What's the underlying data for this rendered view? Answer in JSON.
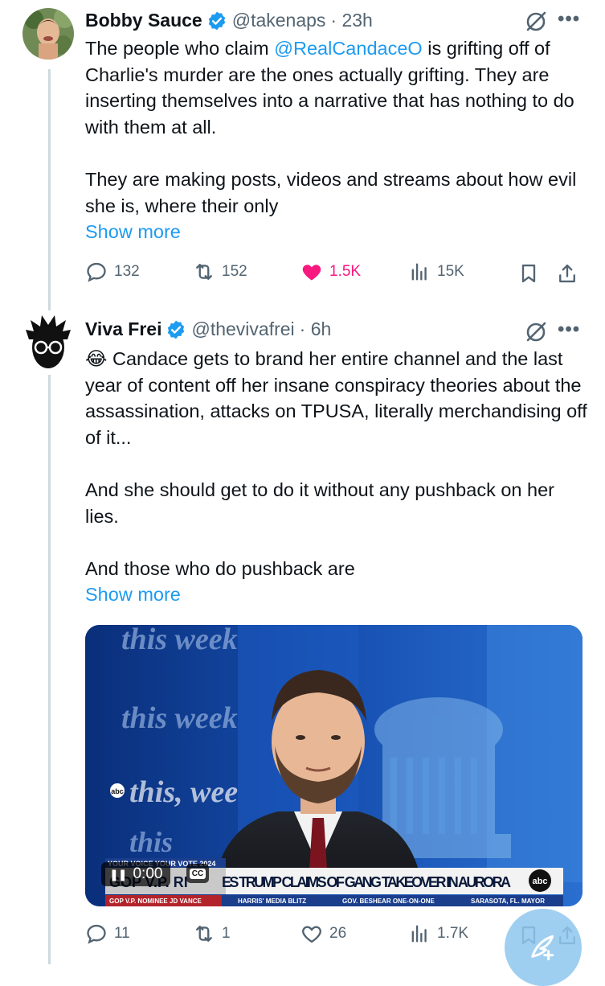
{
  "tweets": [
    {
      "name": "Bobby Sauce",
      "handle": "@takenaps",
      "time": "· 23h",
      "body_pre": "The people who claim ",
      "mention": "@RealCandaceO",
      "body_post": " is grifting off of Charlie's murder are the ones actually grifting. They are inserting themselves into a narrative that has nothing to do with them at all.",
      "body_p2": "They are making posts, videos and streams about how evil she is, where their only",
      "show_more": "Show more",
      "replies": "132",
      "reposts": "152",
      "likes": "1.5K",
      "views": "15K",
      "liked": true
    },
    {
      "name": "Viva Frei",
      "handle": "@thevivafrei",
      "time": "· 6h",
      "emoji": "😂",
      "body_p1": " Candace gets to brand her entire channel and the last year of content off her insane conspiracy theories about the assassination, attacks on TPUSA, literally merchandising off of it...",
      "body_p2": "And she should get to do it without any pushback on her lies.",
      "body_p3": "And those who do pushback are",
      "show_more": "Show more",
      "replies": "11",
      "reposts": "1",
      "likes": "26",
      "views": "1.7K",
      "liked": false,
      "video": {
        "time": "0:00",
        "cc": "CC",
        "bg_logo_1": "this week",
        "bg_logo_2": "this week",
        "bg_logo_3": "this, wee",
        "bg_logo_4": "this",
        "network": "abc",
        "banner_tag": "YOUR VOICE YOUR VOTE 2024",
        "chyron_left": "GOP V.P. RI",
        "chyron": "ES TRUMP CLAIMS OF GANG TAKEOVER IN AURORA",
        "ticker": [
          "GOP V.P. NOMINEE JD VANCE",
          "HARRIS' MEDIA BLITZ",
          "GOV. BESHEAR ONE-ON-ONE",
          "SARASOTA, FL. MAYOR"
        ]
      }
    }
  ],
  "colors": {
    "accent": "#1d9bf0",
    "like": "#f91880",
    "muted": "#536471",
    "text": "#0f1419"
  }
}
